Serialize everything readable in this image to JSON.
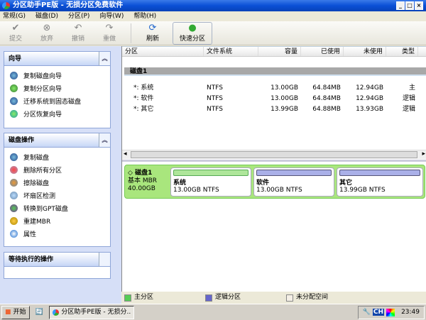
{
  "window": {
    "title": "分区助手PE版 - 无损分区免费软件"
  },
  "menu": [
    "常规(G)",
    "磁盘(D)",
    "分区(P)",
    "向导(W)",
    "帮助(H)"
  ],
  "toolbar": {
    "commit": "提交",
    "discard": "放弃",
    "undo": "撤销",
    "redo": "重做",
    "refresh": "刷新",
    "quick": "快速分区"
  },
  "wizard": {
    "title": "向导",
    "items": [
      "复制磁盘向导",
      "复制分区向导",
      "迁移系统到固态磁盘",
      "分区恢复向导"
    ]
  },
  "diskops": {
    "title": "磁盘操作",
    "items": [
      "复制磁盘",
      "删除所有分区",
      "擦除磁盘",
      "坏扇区检测",
      "转换到GPT磁盘",
      "重建MBR",
      "属性"
    ]
  },
  "pending": {
    "title": "等待执行的操作"
  },
  "table": {
    "headers": [
      "分区",
      "文件系统",
      "容量",
      "已使用",
      "未使用",
      "类型"
    ],
    "disk": "磁盘1",
    "rows": [
      [
        "*: 系统",
        "NTFS",
        "13.00GB",
        "64.84MB",
        "12.94GB",
        "主"
      ],
      [
        "*: 软件",
        "NTFS",
        "13.00GB",
        "64.84MB",
        "12.94GB",
        "逻辑"
      ],
      [
        "*: 其它",
        "NTFS",
        "13.99GB",
        "64.88MB",
        "13.93GB",
        "逻辑"
      ]
    ]
  },
  "diskmap": {
    "name": "磁盘1",
    "type": "基本 MBR",
    "size": "40.00GB",
    "parts": [
      {
        "name": "系统",
        "info": "13.00GB NTFS"
      },
      {
        "name": "软件",
        "info": "13.00GB NTFS"
      },
      {
        "name": "其它",
        "info": "13.99GB NTFS"
      }
    ]
  },
  "legend": [
    "主分区",
    "逻辑分区",
    "未分配空间"
  ],
  "taskbar": {
    "start": "开始",
    "task": "分区助手PE版 - 无损分...",
    "lang": "CH",
    "clock": "23:49"
  }
}
